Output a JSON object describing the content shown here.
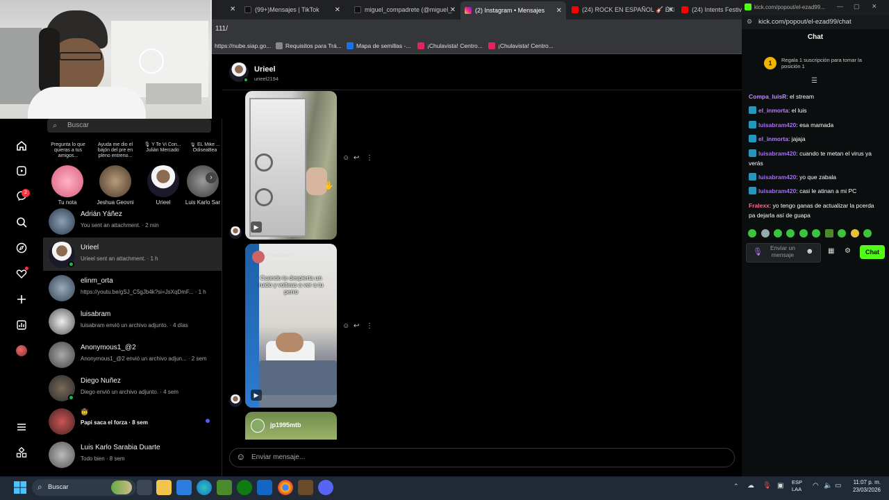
{
  "browser": {
    "tabs": [
      {
        "label": "(99+)Mensajes | TikTok"
      },
      {
        "label": "miguel_compadrete (@miguel_"
      },
      {
        "label": "(2) Instagram • Mensajes"
      },
      {
        "label": "(24) ROCK EN ESPAÑOL 🎸 ÉXI"
      },
      {
        "label": "(24) Intents Festival"
      }
    ],
    "url_fragment": "111/",
    "bookmarks": [
      "https://nube.siap.go...",
      "Requisitos para Trá...",
      "Mapa de semillas -...",
      "¡Chulavista! Centro...",
      "¡Chulavista! Centro..."
    ]
  },
  "instagram": {
    "search_placeholder": "Buscar",
    "notes": [
      {
        "text": "Pregunta lo que quieras a tus amigos..."
      },
      {
        "text": "Ayuda me dio el bajón del pre en pleno entreno..."
      },
      {
        "text": "🎙 Y Te Vi Con... Julián Mercado"
      },
      {
        "text": "🎙 EL Mike ... OdiseaBea"
      }
    ],
    "stories": [
      "Tu nota",
      "Jeshua Geovni",
      "Urieel",
      "Luis Karlo Sar"
    ],
    "notifications_badge": "2",
    "conversations": [
      {
        "name": "Adrián Yáñez",
        "preview": "You sent an attachment. · 2 min"
      },
      {
        "name": "Urieel",
        "preview": "Urieel sent an attachment. · 1 h"
      },
      {
        "name": "elinm_orta",
        "preview": "https://youtu.be/gSJ_C5gJb4k?si=JsXqDmF... · 1 h"
      },
      {
        "name": "luisabram",
        "preview": "luisabram envió un archivo adjunto. · 4 días"
      },
      {
        "name": "Anonymous1_@2",
        "preview": "Anonymous1_@2 envió un archivo adjun... · 2 sem"
      },
      {
        "name": "Diego Nuñez",
        "preview": "Diego envió un archivo adjunto. · 4 sem"
      },
      {
        "name": "Papi saca el forza",
        "emoji": "🤠",
        "preview": "Papi saca el forza · 8 sem"
      },
      {
        "name": "Luis Karlo Sarabia Duarte",
        "preview": "Todo bien · 8 sem"
      }
    ],
    "chat": {
      "name": "Urieel",
      "username": "urieel2194",
      "reel2_caption": "Cuando te despierta un ruido y volteas a ver a tu perro",
      "reel2_user": "mimibailee",
      "reel3_user": "jp1995mtb",
      "composer_placeholder": "Enviar mensaje..."
    }
  },
  "kick": {
    "url": "kick.com/popout/el-ezad99/chat",
    "window_title": "kick.com/popout/el-ezad99...",
    "header": "Chat",
    "gift_rank": "1",
    "gift_text": "Regala 1 suscripción para tomar la posición 1",
    "messages": [
      {
        "user": "Compa_luisR",
        "color": "#c38cff",
        "text": ": el stream",
        "badge": false
      },
      {
        "user": "el_inmorta",
        "color": "#b57bff",
        "text": ": el luis",
        "badge": true
      },
      {
        "user": "luisabram420",
        "color": "#a96bff",
        "text": ": esa mamada",
        "badge": true
      },
      {
        "user": "el_inmorta",
        "color": "#b57bff",
        "text": ": jajaja",
        "badge": true
      },
      {
        "user": "luisabram420",
        "color": "#a96bff",
        "text": ": cuando te metan el virus ya verás",
        "badge": true
      },
      {
        "user": "luisabram420",
        "color": "#a96bff",
        "text": ": yo que zabala",
        "badge": true
      },
      {
        "user": "luisabram420",
        "color": "#a96bff",
        "text": ": casi le atinan a mi PC",
        "badge": true
      },
      {
        "user": "Fralexx",
        "color": "#ff6b8b",
        "text": ": yo tengo ganas de actualizar la pcerda pa dejarla así de guapa",
        "badge": false
      }
    ],
    "input_placeholder": "Enviar un mensaje",
    "send_label": "Chat",
    "accent": "#53fc18"
  },
  "taskbar": {
    "search_label": "Buscar",
    "lang": "ESP\nLAA",
    "time": "11:07 p. m.",
    "date": "23/03/2026"
  }
}
